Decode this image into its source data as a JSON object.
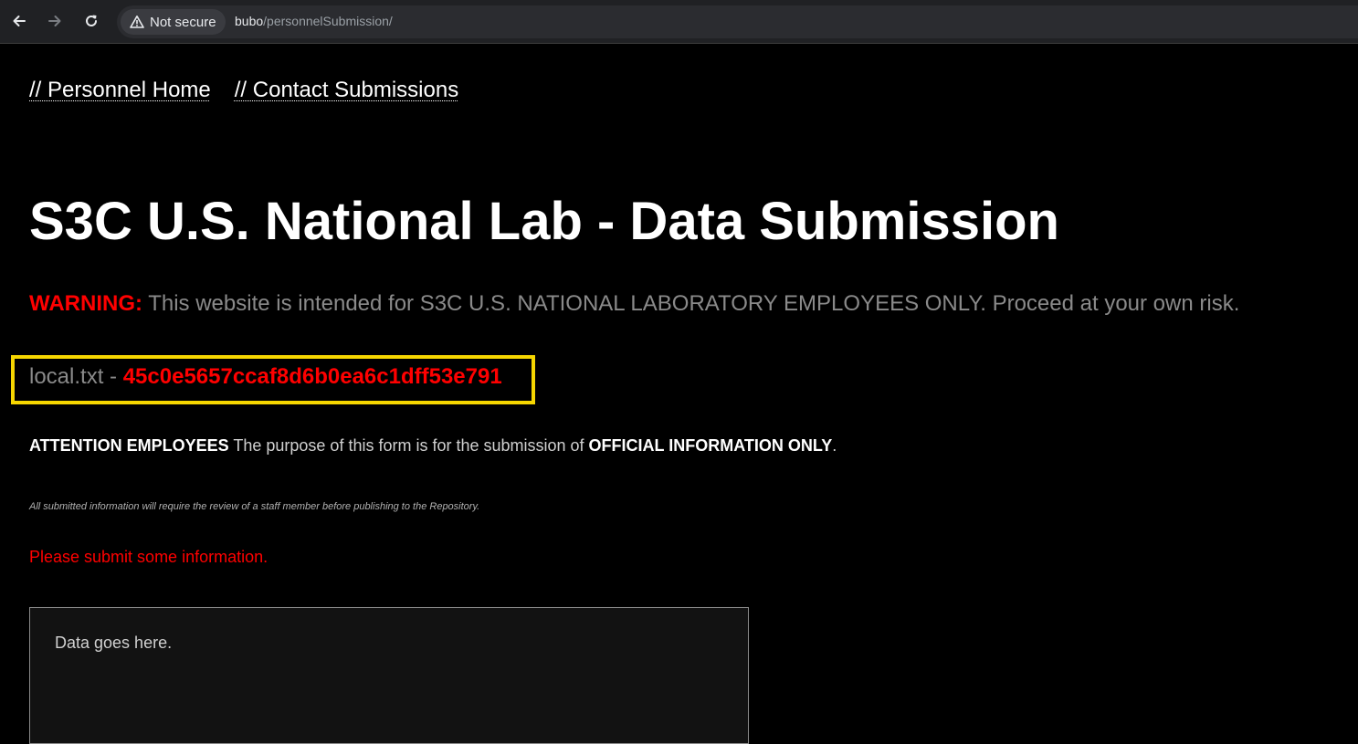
{
  "browser": {
    "security_label": "Not secure",
    "url_host": "bubo",
    "url_path": "/personnelSubmission/"
  },
  "nav": {
    "items": [
      {
        "label": "// Personnel Home"
      },
      {
        "label": "// Contact Submissions"
      }
    ]
  },
  "main": {
    "title": "S3C U.S. National Lab - Data Submission",
    "warning_label": "WARNING:",
    "warning_text": " This website is intended for S3C U.S. NATIONAL LABORATORY EMPLOYEES ONLY. Proceed at your own risk.",
    "flag_label": "local.txt - ",
    "flag_value": "45c0e5657ccaf8d6b0ea6c1dff53e791",
    "attention_bold": "ATTENTION EMPLOYEES",
    "attention_text": " The purpose of this form is for the submission of ",
    "attention_bold2": "OFFICIAL INFORMATION ONLY",
    "attention_end": ".",
    "review_note": "All submitted information will require the review of a staff member before publishing to the Repository.",
    "error_message": "Please submit some information.",
    "textarea_placeholder": "Data goes here."
  },
  "colors": {
    "warning_red": "#ff0000",
    "highlight_yellow": "#f6d600",
    "background": "#000000"
  },
  "icons": [
    "back-arrow-icon",
    "forward-arrow-icon",
    "reload-icon",
    "warning-triangle-icon"
  ]
}
